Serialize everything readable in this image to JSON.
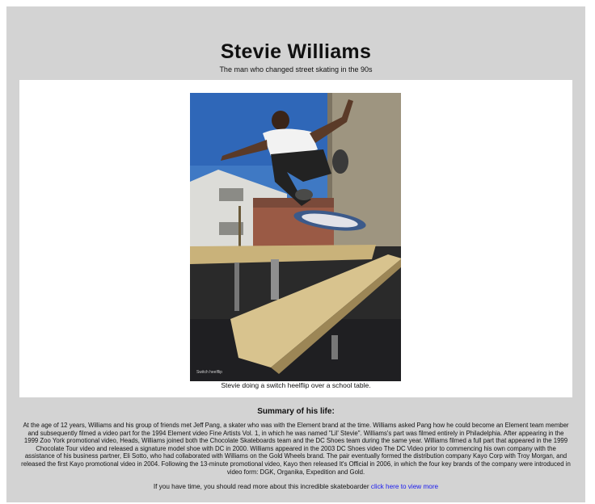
{
  "page": {
    "title": "Stevie Williams",
    "subtitle": "The man who changed street skating in the 90s"
  },
  "image": {
    "caption": "Stevie doing a switch heelflip over a school table.",
    "corner_text": "Switch heelflip"
  },
  "summary": {
    "heading": "Summary of his life:",
    "text": "At the age of 12 years, Williams and his group of friends met Jeff Pang, a skater who was with the Element brand at the time. Williams asked Pang how he could become an Element team member and subsequently filmed a video part for the 1994 Element video Fine Artists Vol. 1, in which he was named \"Lil' Stevie\". Williams's part was filmed entirely in Philadelphia. After appearing in the 1999 Zoo York promotional video, Heads, Williams joined both the Chocolate Skateboards team and the DC Shoes team during the same year. Williams filmed a full part that appeared in the 1999 Chocolate Tour video and released a signature model shoe with DC in 2000. Williams appeared in the 2003 DC Shoes video The DC Video prior to commencing his own company with the assistance of his business partner, Eli Sotto, who had collaborated with Williams on the Gold Wheels brand. The pair eventually formed the distribution company Kayo Corp with Troy Morgan, and released the first Kayo promotional video in 2004. Following the 13-minute promotional video, Kayo then released It's Official in 2006, in which the four key brands of the company were introduced in video form: DGK, Organika, Expedition and Gold."
  },
  "footer": {
    "prefix": "If you have time, you should read more about this incredible skateboarder ",
    "link_text": "click here to view more"
  },
  "colors": {
    "background": "#d3d3d3",
    "link": "#1a1aee"
  }
}
